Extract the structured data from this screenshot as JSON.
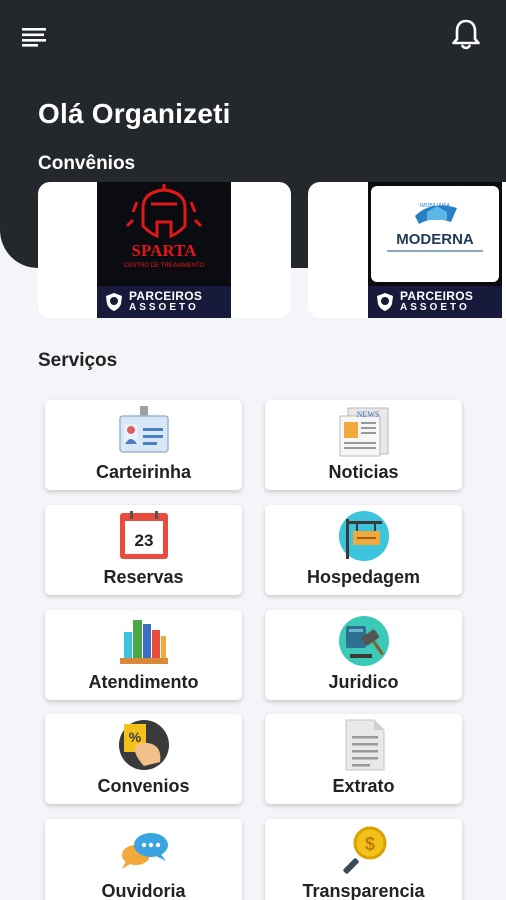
{
  "header": {
    "greeting": "Olá Organizeti",
    "convenios_title": "Convênios"
  },
  "icons": {
    "menu": "menu-icon",
    "notifications": "bell-icon"
  },
  "partners": [
    {
      "name": "SPARTA",
      "subtitle": "CENTRO DE TREINAMENTO",
      "badge_line1": "PARCEIROS",
      "badge_line2": "ASSOETO"
    },
    {
      "name": "MODERNA",
      "subtitle": "IMOBILIÁRIA",
      "badge_line1": "PARCEIROS",
      "badge_line2": "ASSOETO"
    }
  ],
  "services_title": "Serviços",
  "services": [
    {
      "label": "Carteirinha",
      "icon": "id-card-icon"
    },
    {
      "label": "Noticias",
      "icon": "newspaper-icon"
    },
    {
      "label": "Reservas",
      "icon": "calendar-icon",
      "icon_text": "23"
    },
    {
      "label": "Hospedagem",
      "icon": "hotel-sign-icon"
    },
    {
      "label": "Atendimento",
      "icon": "books-icon"
    },
    {
      "label": "Juridico",
      "icon": "gavel-icon"
    },
    {
      "label": "Convenios",
      "icon": "discount-icon"
    },
    {
      "label": "Extrato",
      "icon": "document-icon"
    },
    {
      "label": "Ouvidoria",
      "icon": "chat-bubbles-icon"
    },
    {
      "label": "Transparencia",
      "icon": "magnifier-dollar-icon"
    }
  ],
  "colors": {
    "header_bg": "#24272c",
    "page_bg": "#f4f5f9",
    "partner_badge": "#171a3a",
    "sparta_red": "#e01818"
  }
}
